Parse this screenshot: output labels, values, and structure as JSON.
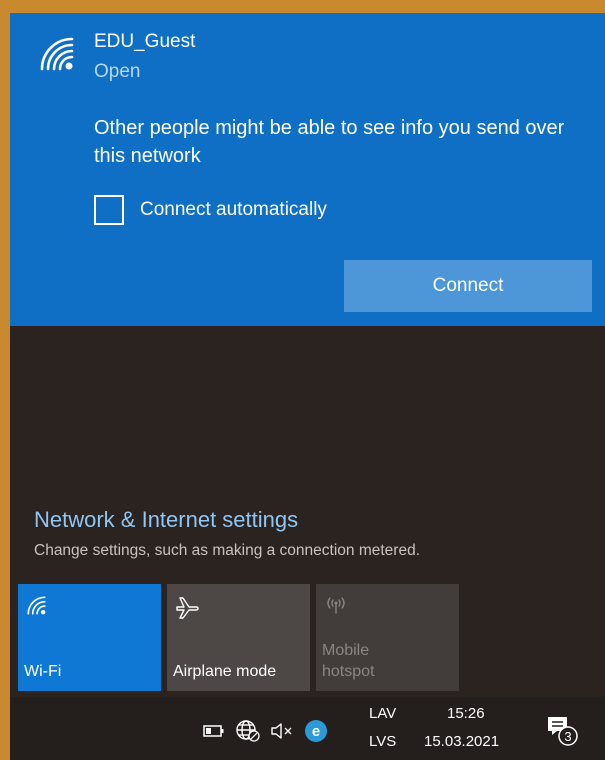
{
  "network": {
    "name": "EDU_Guest",
    "status": "Open",
    "warning": "Other people might be able to see info you send over this network",
    "auto_connect_label": "Connect automatically",
    "auto_connect_checked": false,
    "connect_label": "Connect"
  },
  "settings": {
    "title": "Network & Internet settings",
    "subtitle": "Change settings, such as making a connection metered."
  },
  "quick_actions": {
    "wifi": "Wi-Fi",
    "airplane": "Airplane mode",
    "hotspot_line1": "Mobile",
    "hotspot_line2": "hotspot"
  },
  "taskbar": {
    "lang_top": "LAV",
    "lang_bottom": "LVS",
    "time": "15:26",
    "date": "15.03.2021",
    "notification_count": "3",
    "icons": [
      "battery-icon",
      "network-globe-icon",
      "volume-muted-icon",
      "edge-icon",
      "action-center-icon"
    ]
  },
  "colors": {
    "accent": "#0f6fc4",
    "button": "#4d97d9",
    "link": "#90c6f3",
    "background": "#2a2320"
  }
}
